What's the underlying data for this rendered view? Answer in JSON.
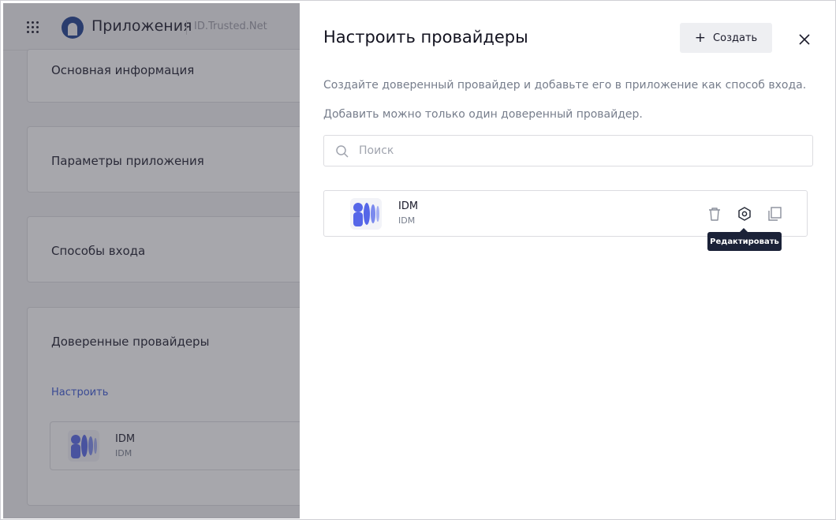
{
  "header": {
    "app_title": "Приложения",
    "app_subtitle": "ID.Trusted.Net"
  },
  "background_cards": [
    {
      "title": "Основная информация"
    },
    {
      "title": "Параметры приложения"
    },
    {
      "title": "Способы входа"
    },
    {
      "title": "Доверенные провайдеры",
      "link": "Настроить",
      "provider": {
        "name": "IDM",
        "type": "IDM"
      }
    }
  ],
  "drawer": {
    "title": "Настроить провайдеры",
    "create_label": "Создать",
    "description": "Создайте доверенный провайдер и добавьте его в приложение как способ входа.",
    "limit_note": "Добавить можно только один доверенный провайдер.",
    "search": {
      "placeholder": "Поиск",
      "value": ""
    },
    "providers": [
      {
        "name": "IDM",
        "type": "IDM"
      }
    ],
    "tooltip": "Редактировать"
  },
  "colors": {
    "accent": "#3856d4",
    "logo_blue": "#5566e8",
    "tooltip_bg": "#1b2238"
  },
  "icons": {
    "apps": "grid-icon",
    "logo": "logo-icon",
    "create": "plus-icon",
    "close": "close-icon",
    "search": "search-icon",
    "delete": "trash-icon",
    "edit": "gear-icon",
    "copy": "copy-icon"
  }
}
